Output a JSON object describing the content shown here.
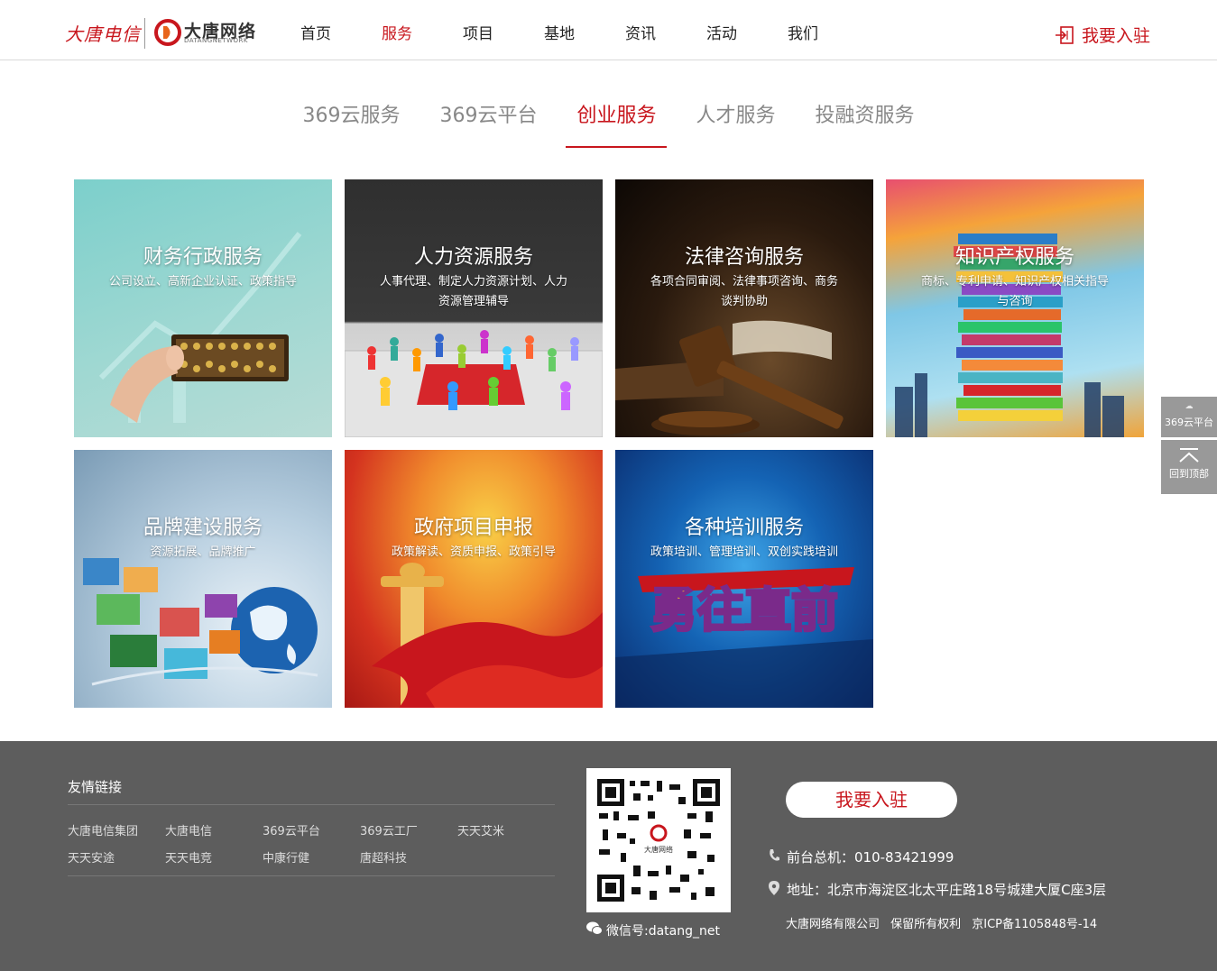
{
  "header": {
    "logo_script": "大唐电信",
    "logo_name": "大唐网络",
    "logo_en": "DATANGNETWORK",
    "nav": [
      "首页",
      "服务",
      "项目",
      "基地",
      "资讯",
      "活动",
      "我们"
    ],
    "nav_active": "服务",
    "join_label": "我要入驻"
  },
  "tabs": {
    "items": [
      "369云服务",
      "369云平台",
      "创业服务",
      "人才服务",
      "投融资服务"
    ],
    "active": "创业服务"
  },
  "cards": [
    {
      "title": "财务行政服务",
      "desc": "公司设立、高新企业认证、政策指导",
      "image": "abacus-hand"
    },
    {
      "title": "人力资源服务",
      "desc": "人事代理、制定人力资源计划、人力资源管理辅导",
      "image": "puzzle-people"
    },
    {
      "title": "法律咨询服务",
      "desc": "各项合同审阅、法律事项咨询、商务谈判协助",
      "image": "gavel-books"
    },
    {
      "title": "知识产权服务",
      "desc": "商标、专利申请、知识产权相关指导与咨询",
      "image": "book-stack-city"
    },
    {
      "title": "品牌建设服务",
      "desc": "资源拓展、品牌推广",
      "image": "globe-screens"
    },
    {
      "title": "政府项目申报",
      "desc": "政策解读、资质申报、政策引导",
      "image": "huabiao-red-ribbon"
    },
    {
      "title": "各种培训服务",
      "desc": "政策培训、管理培训、双创实践培训",
      "image": "yong-wang-zhi-qian-banner",
      "banner_text": "勇往直前"
    }
  ],
  "side": {
    "cloud_label": "369云平台",
    "top_label": "回到顶部"
  },
  "footer": {
    "friend_title": "友情链接",
    "friend_links": [
      "大唐电信集团",
      "大唐电信",
      "369云平台",
      "369云工厂",
      "天天艾米",
      "天天安途",
      "天天电竞",
      "中康行健",
      "唐超科技"
    ],
    "wechat_label": "微信号:datang_net",
    "qr_label": "大唐网络",
    "join_button": "我要入驻",
    "phone": "前台总机：010-83421999",
    "address": "地址：北京市海淀区北太平庄路18号城建大厦C座3层",
    "copyright": "大唐网络有限公司 保留所有权利 京ICP备1105848号-14"
  },
  "colors": {
    "brand_red": "#c8161d",
    "footer_bg": "#5d5d5d",
    "side_bg": "#999999"
  }
}
